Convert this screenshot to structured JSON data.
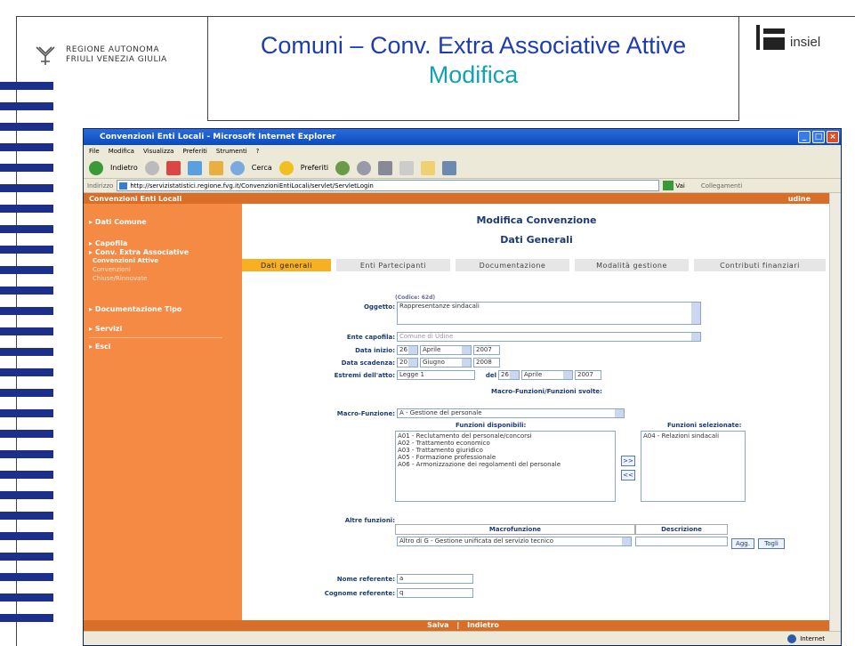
{
  "slide": {
    "logo_line1": "REGIONE AUTONOMA",
    "logo_line2": "FRIULI VENEZIA GIULIA",
    "title": "Comuni – Conv. Extra Associative Attive",
    "subtitle": "Modifica",
    "brand": "insiel"
  },
  "browser": {
    "title": "Convenzioni Enti Locali - Microsoft Internet Explorer",
    "menu": [
      "File",
      "Modifica",
      "Visualizza",
      "Preferiti",
      "Strumenti",
      "?"
    ],
    "toolbar": {
      "back": "Indietro",
      "search": "Cerca",
      "favorites": "Preferiti"
    },
    "address_label": "Indirizzo",
    "url": "http://servizistatistici.regione.fvg.it/ConvenzioniEntiLocali/servlet/ServletLogin",
    "go": "Vai",
    "links": "Collegamenti",
    "status_zone": "Internet"
  },
  "page": {
    "app_title": "Convenzioni Enti Locali",
    "user": "udine",
    "heading": "Modifica Convenzione",
    "subheading": "Dati Generali",
    "footer_save": "Salva",
    "footer_sep": "|",
    "footer_back": "Indietro"
  },
  "sidebar": {
    "dati_comune": "Dati Comune",
    "capofila": "Capofila",
    "conv_extra": "Conv. Extra Associative",
    "attive": "Convenzioni Attive",
    "convenzioni": "Convenzioni",
    "chiuse": "Chiuse/Rinnovate",
    "doc_tipo": "Documentazione Tipo",
    "servizi": "Servizi",
    "esci": "Esci"
  },
  "tabs": [
    "Dati generali",
    "Enti Partecipanti",
    "Documentazione",
    "Modalità gestione",
    "Contributi finanziari"
  ],
  "form": {
    "codice": "(Codice: 62d)",
    "oggetto_label": "Oggetto:",
    "oggetto_value": "Rappresentanze sindacali",
    "ente_label": "Ente capofila:",
    "ente_value": "Comune di Udine",
    "data_inizio_label": "Data inizio:",
    "data_inizio": {
      "day": "26",
      "month": "Aprile",
      "year": "2007"
    },
    "data_scadenza_label": "Data scadenza:",
    "data_scadenza": {
      "day": "20",
      "month": "Giugno",
      "year": "2008"
    },
    "estremi_label": "Estremi dell'atto:",
    "estremi_value": "Legge 1",
    "del_label": "del",
    "estremi_data": {
      "day": "26",
      "month": "Aprile",
      "year": "2007"
    },
    "macro_head": "Macro-Funzioni/Funzioni svolte:",
    "macro_label": "Macro-Funzione:",
    "macro_value": "A - Gestione del personale",
    "disponibili_head": "Funzioni disponibili:",
    "disponibili": [
      "A01 - Reclutamento del personale/concorsi",
      "A02 - Trattamento economico",
      "A03 - Trattamento giuridico",
      "A05 - Formazione professionale",
      "A06 - Armonizzazione dei regolamenti del personale"
    ],
    "selezionate_head": "Funzioni selezionate:",
    "selezionate": [
      "A04 - Relazioni sindacali"
    ],
    "add_btn": ">>",
    "remove_btn": "<<",
    "altre_label": "Altre funzioni:",
    "col_macro": "Macrofunzione",
    "col_descr": "Descrizione",
    "altre_macro_value": "Altro di G - Gestione unificata del servizio tecnico",
    "agg_btn": "Agg.",
    "togli_btn": "Togli",
    "nome_label": "Nome referente:",
    "nome_value": "a",
    "cognome_label": "Cognome referente:",
    "cognome_value": "q"
  }
}
